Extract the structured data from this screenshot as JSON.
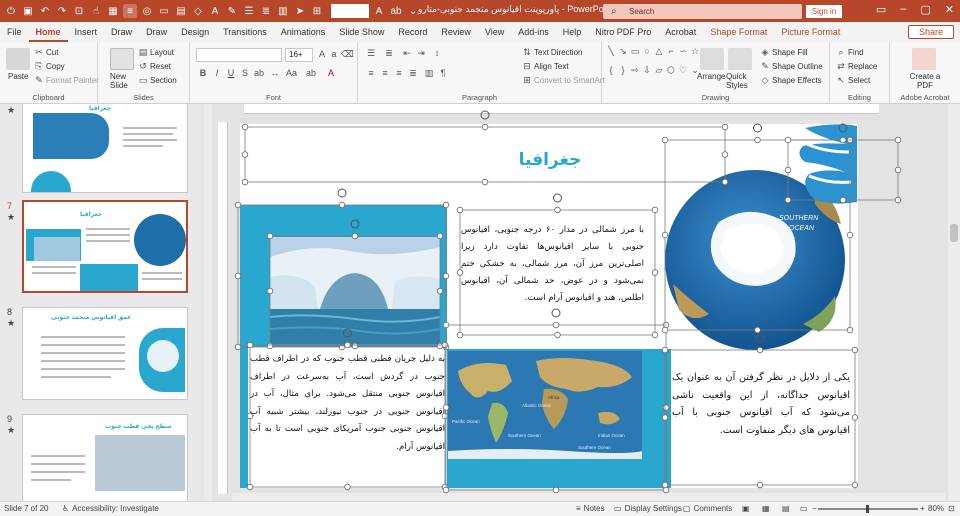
{
  "app": {
    "doc_title": "پاورپوینت اقیانوس منجمد جنوبی-متارو  -  PowerPoint",
    "search_placeholder": "Search",
    "signin_label": "Sign in",
    "share_label": "Share",
    "accent": "#b7472a"
  },
  "menu": {
    "items": [
      "File",
      "Home",
      "Insert",
      "Draw",
      "Draw",
      "Design",
      "Transitions",
      "Animations",
      "Slide Show",
      "Record",
      "Review",
      "View",
      "Add-ins",
      "Help",
      "Nitro PDF Pro",
      "Acrobat"
    ],
    "contextual": [
      "Shape Format",
      "Picture Format"
    ]
  },
  "ribbon": {
    "clipboard": {
      "paste": "Paste",
      "cut": "Cut",
      "copy": "Copy",
      "format_painter": "Format Painter",
      "label": "Clipboard"
    },
    "slides": {
      "new_slide": "New Slide",
      "layout": "Layout",
      "reset": "Reset",
      "section": "Section",
      "label": "Slides"
    },
    "font": {
      "size": "16+",
      "label": "Font"
    },
    "paragraph": {
      "text_direction": "Text Direction",
      "align_text": "Align Text",
      "smartart": "Convert to SmartArt",
      "label": "Paragraph"
    },
    "drawing": {
      "arrange": "Arrange",
      "quick_styles": "Quick Styles",
      "shape_fill": "Shape Fill",
      "shape_outline": "Shape Outline",
      "shape_effects": "Shape Effects",
      "label": "Drawing"
    },
    "editing": {
      "find": "Find",
      "replace": "Replace",
      "select": "Select",
      "label": "Editing"
    },
    "acrobat": {
      "create_pdf": "Create a PDF",
      "label": "Adobe Acrobat"
    }
  },
  "thumbnails": [
    {
      "number": "",
      "title": "جغرافیا"
    },
    {
      "number": "7",
      "title": "جغرافیا"
    },
    {
      "number": "8",
      "title": "عمق اقیانوس منجمد جنوبی"
    },
    {
      "number": "9",
      "title": "سطح یخی قطب جنوب"
    }
  ],
  "slide": {
    "title": "جغرافیا",
    "para_top": "با مرز شمالی در مدار ۶۰ درجه جنوبی، اقیانوس جنوبی با سایر اقیانوس‌ها تفاوت دارد زیرا اصلی‌ترین مرز آن، مرز شمالی، به خشکی ختم نمی‌شود و در عوض، حد شمالی آن، اقیانوس اطلس، هند و اقیانوس آرام است.",
    "para_left": "به دلیل جریان قطبی قطب جنوب که در اطراف قطب جنوب در گردش است، آب به‌سرعت در اطراف اقیانوس جنوبی منتقل می‌شود. برای مثال، آب در اقیانوس جنوبی در جنوب نیوزلند، بیشتر شبیه آب اقیانوس جنوبی جنوب آمریکای جنوبی است تا به آب اقیانوس آرام.",
    "para_right": "یکی از دلایل در نظر گرفتن آن به عنوان یک اقیانوس جداگانه، از این واقعیت ناشی می‌شود که آب اقیانوس جنوبی با آب اقیانوس های دیگر متفاوت است.",
    "globe_label_1": "SOUTHERN",
    "globe_label_2": "OCEAN",
    "map_labels": [
      "Atlantic Ocean",
      "Pacific Ocean",
      "Southern Ocean",
      "Indian Ocean",
      "Southern Ocean",
      "Africa"
    ],
    "accent": "#29a7cf"
  },
  "status": {
    "slide_of": "Slide 7 of 20",
    "accessibility": "Accessibility: Investigate",
    "notes": "Notes",
    "display_settings": "Display Settings",
    "comments": "Comments",
    "zoom": "80%"
  }
}
